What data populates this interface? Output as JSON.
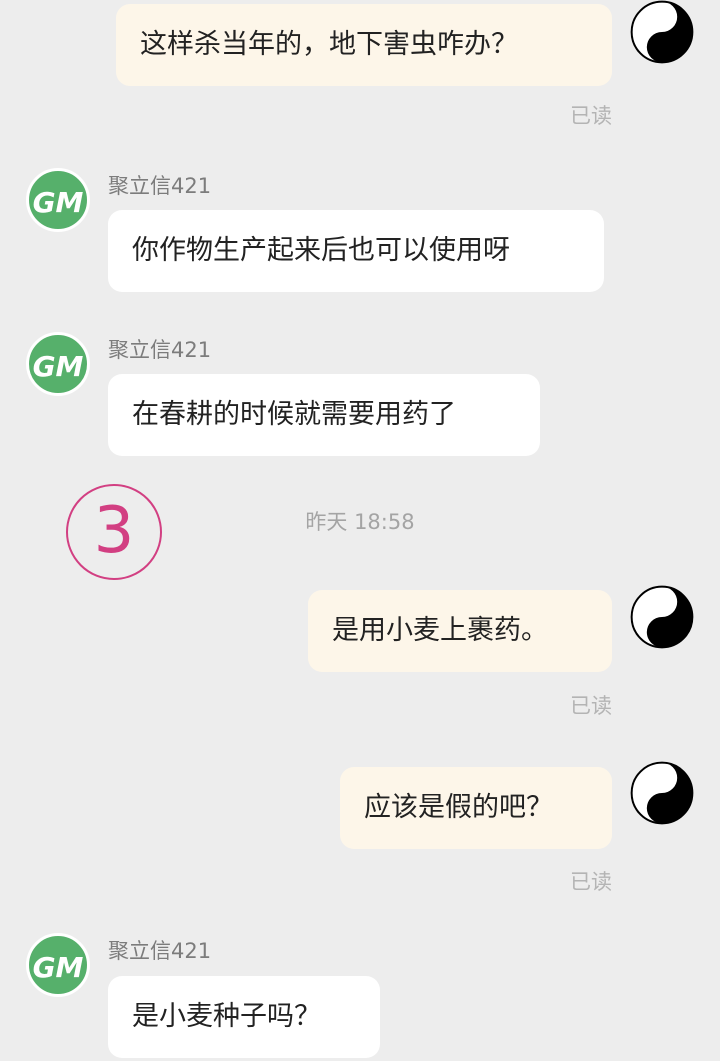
{
  "messages": [
    {
      "text": "这样杀当年的，地下害虫咋办？",
      "status": "已读"
    },
    {
      "sender": "聚立信421",
      "text": "你作物生产起来后也可以使用呀"
    },
    {
      "sender": "聚立信421",
      "text": "在春耕的时候就需要用药了"
    },
    {
      "text": "是用小麦上裹药。",
      "status": "已读"
    },
    {
      "text": "应该是假的吧？",
      "status": "已读"
    },
    {
      "sender": "聚立信421",
      "text": "是小麦种子吗？"
    }
  ],
  "timestamp": "昨天  18:58",
  "annotation": "3",
  "avatar": {
    "contact_logo": "GM",
    "self_icon": "yin-yang-icon"
  },
  "colors": {
    "outgoing_bubble": "#fdf6e9",
    "incoming_bubble": "#ffffff",
    "background": "#ededed",
    "logo_green": "#56b06b",
    "annotation": "#d23f82"
  }
}
